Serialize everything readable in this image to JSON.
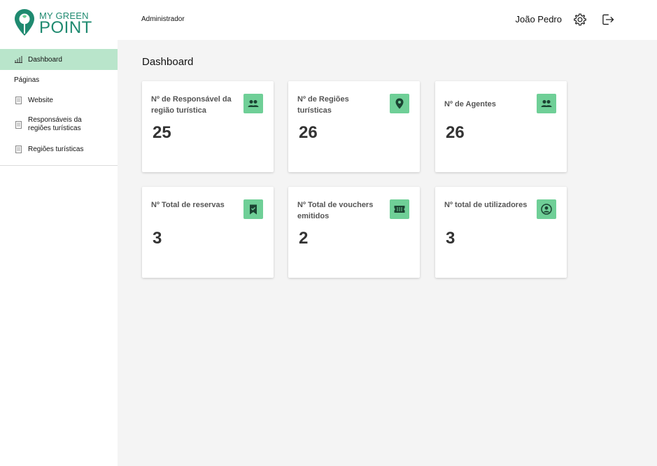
{
  "app": {
    "logo_line1": "MY GREEN",
    "logo_line2": "POINT",
    "brand_color": "#1f8a70",
    "accent_color": "#6fcf97",
    "active_nav_color": "#b9e5cb"
  },
  "sidebar": {
    "items": [
      {
        "label": "Dashboard",
        "icon": "bar-chart-icon",
        "active": true
      },
      {
        "label": "Website",
        "icon": "document-icon",
        "active": false
      },
      {
        "label": "Responsáveis da regiões turísticas",
        "icon": "document-icon",
        "active": false
      },
      {
        "label": "Regiões turísticas",
        "icon": "document-icon",
        "active": false
      }
    ],
    "section_label": "Páginas"
  },
  "header": {
    "role": "Administrador",
    "user_name": "João Pedro",
    "settings_icon": "gear-icon",
    "logout_icon": "logout-icon"
  },
  "main": {
    "title": "Dashboard",
    "cards": [
      {
        "label": "Nº de Responsável da região turística",
        "value": "25",
        "icon": "people-icon"
      },
      {
        "label": "Nº de Regiões turísticas",
        "value": "26",
        "icon": "location-pin-icon"
      },
      {
        "label": "Nº de Agentes",
        "value": "26",
        "icon": "people-icon"
      },
      {
        "label": "Nº Total de reservas",
        "value": "3",
        "icon": "bookmark-check-icon"
      },
      {
        "label": "Nº Total de vouchers emitidos",
        "value": "2",
        "icon": "ticket-icon"
      },
      {
        "label": "Nº total de utilizadores",
        "value": "3",
        "icon": "user-circle-icon"
      }
    ]
  }
}
